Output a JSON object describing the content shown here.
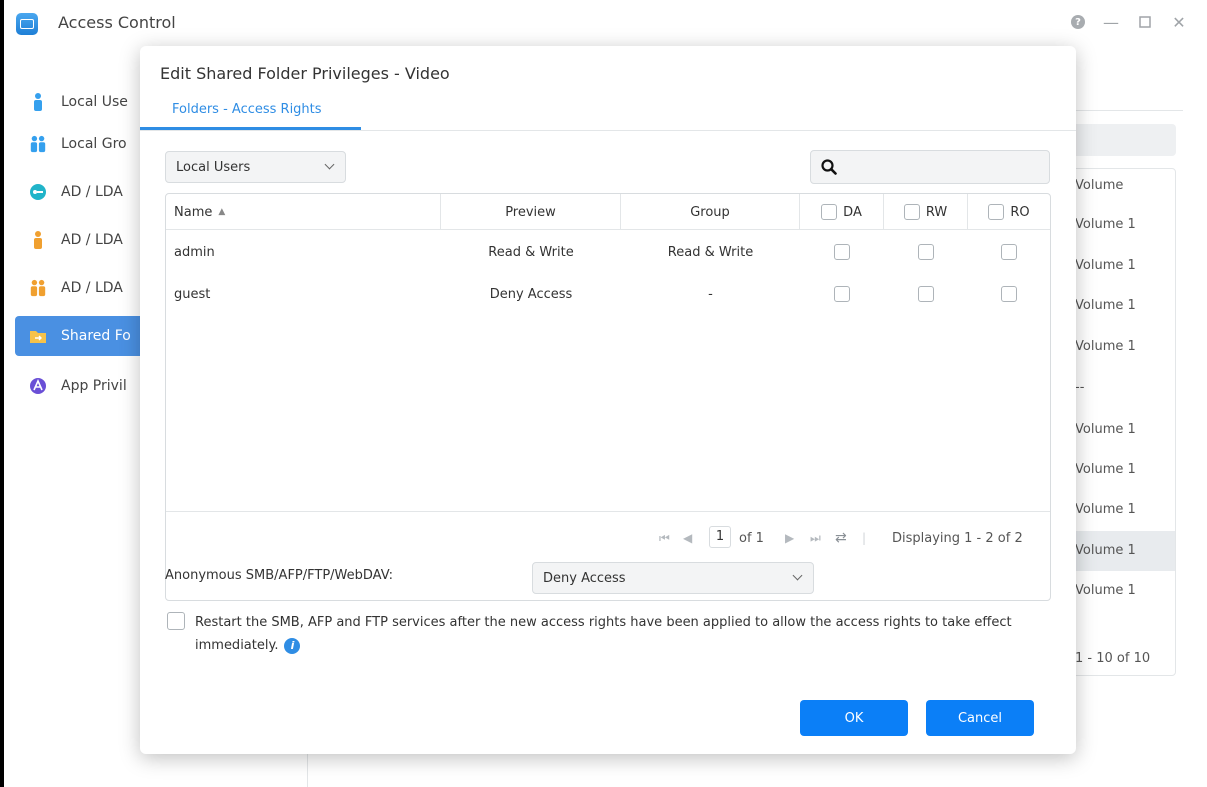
{
  "window": {
    "title": "Access Control"
  },
  "sidebar": {
    "items": [
      {
        "label": "Local Use",
        "icon": "user-icon"
      },
      {
        "label": "Local Gro",
        "icon": "group-icon"
      },
      {
        "label": "AD / LDA",
        "icon": "key-icon"
      },
      {
        "label": "AD / LDA",
        "icon": "user-icon"
      },
      {
        "label": "AD / LDA",
        "icon": "group-icon"
      },
      {
        "label": "Shared Fo",
        "icon": "folder-icon"
      },
      {
        "label": "App Privil",
        "icon": "app-icon"
      }
    ]
  },
  "background": {
    "column_header": "Volume",
    "cells": [
      "Volume 1",
      "Volume 1",
      "Volume 1",
      "Volume 1",
      "--",
      "Volume 1",
      "Volume 1",
      "Volume 1",
      "Volume 1",
      "Volume 1"
    ],
    "footer": "1 - 10 of 10"
  },
  "modal": {
    "title": "Edit Shared Folder Privileges - Video",
    "tab": "Folders - Access Rights",
    "user_type": "Local Users",
    "columns": {
      "name": "Name",
      "preview": "Preview",
      "group": "Group",
      "da": "DA",
      "rw": "RW",
      "ro": "RO"
    },
    "rows": [
      {
        "name": "admin",
        "preview": "Read & Write",
        "group": "Read & Write"
      },
      {
        "name": "guest",
        "preview": "Deny Access",
        "group": "-"
      }
    ],
    "pager": {
      "page": "1",
      "of": "of 1",
      "displaying": "Displaying 1 - 2 of 2"
    },
    "anonymous_label": "Anonymous SMB/AFP/FTP/WebDAV:",
    "anonymous_value": "Deny Access",
    "restart_text": "Restart the SMB, AFP and FTP services after the new access rights have been applied to allow the access rights to take effect immediately.",
    "ok_label": "OK",
    "cancel_label": "Cancel"
  },
  "colors": {
    "accent": "#0b7ff7",
    "sidebar_active": "#4a90e2",
    "tab_active": "#2f8de4"
  }
}
